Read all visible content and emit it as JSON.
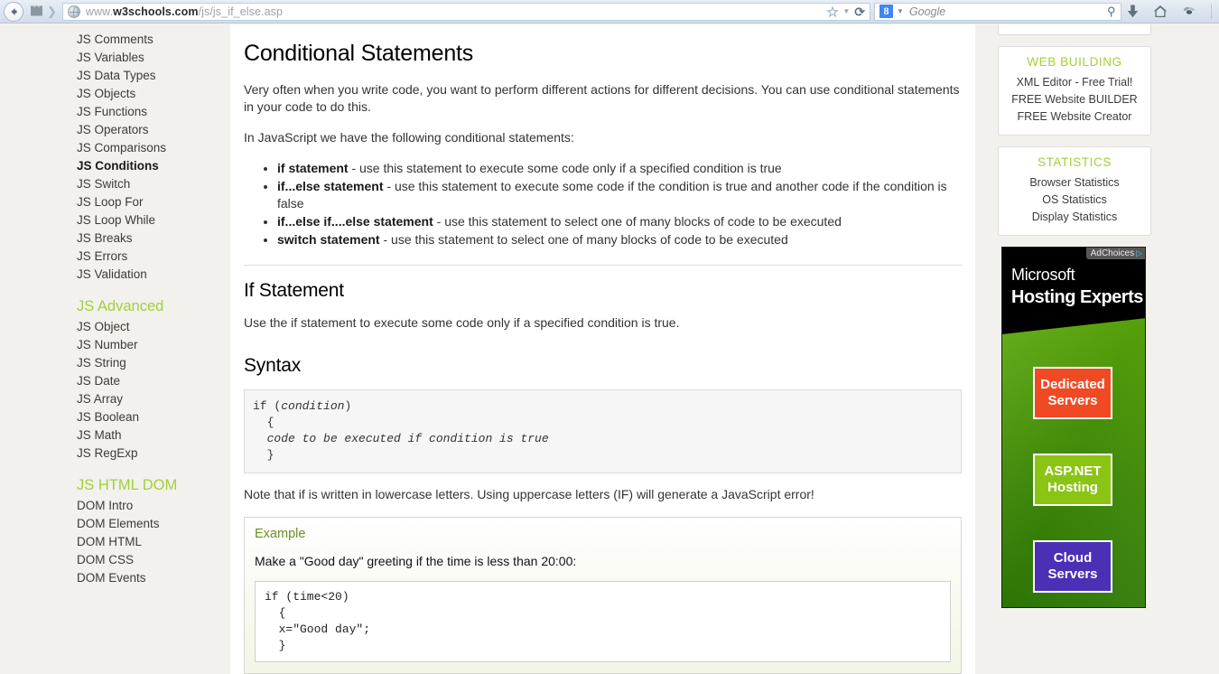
{
  "browser": {
    "back_label": "◀",
    "history_icon_label": "history-list",
    "url_prefix": "www.",
    "url_host": "w3schools.com",
    "url_path": "/js/js_if_else.asp",
    "star_tooltip": "Bookmark this page",
    "reload_label": "⟳",
    "search_engine": "Google",
    "search_engine_badge": "8",
    "search_placeholder": "Google",
    "icons": [
      "download-icon",
      "home-icon",
      "fly-icon"
    ]
  },
  "leftnav": {
    "items": [
      {
        "label": "JS Comments",
        "active": false
      },
      {
        "label": "JS Variables",
        "active": false
      },
      {
        "label": "JS Data Types",
        "active": false
      },
      {
        "label": "JS Objects",
        "active": false
      },
      {
        "label": "JS Functions",
        "active": false
      },
      {
        "label": "JS Operators",
        "active": false
      },
      {
        "label": "JS Comparisons",
        "active": false
      },
      {
        "label": "JS Conditions",
        "active": true
      },
      {
        "label": "JS Switch",
        "active": false
      },
      {
        "label": "JS Loop For",
        "active": false
      },
      {
        "label": "JS Loop While",
        "active": false
      },
      {
        "label": "JS Breaks",
        "active": false
      },
      {
        "label": "JS Errors",
        "active": false
      },
      {
        "label": "JS Validation",
        "active": false
      }
    ],
    "section_advanced": "JS Advanced",
    "advanced_items": [
      {
        "label": "JS Object"
      },
      {
        "label": "JS Number"
      },
      {
        "label": "JS String"
      },
      {
        "label": "JS Date"
      },
      {
        "label": "JS Array"
      },
      {
        "label": "JS Boolean"
      },
      {
        "label": "JS Math"
      },
      {
        "label": "JS RegExp"
      }
    ],
    "section_dom": "JS HTML DOM",
    "dom_items": [
      {
        "label": "DOM Intro"
      },
      {
        "label": "DOM Elements"
      },
      {
        "label": "DOM HTML"
      },
      {
        "label": "DOM CSS"
      },
      {
        "label": "DOM Events"
      }
    ]
  },
  "main": {
    "title": "Conditional Statements",
    "intro": "Very often when you write code, you want to perform different actions for different decisions. You can use conditional statements in your code to do this.",
    "lead": "In JavaScript we have the following conditional statements:",
    "bullets": [
      {
        "term": "if statement",
        "desc": " - use this statement to execute some code only if a specified condition is true"
      },
      {
        "term": "if...else statement",
        "desc": " - use this statement to execute some code if the condition is true and another code if the condition is false"
      },
      {
        "term": "if...else if....else statement",
        "desc": " - use this statement to select one of many blocks of code to be executed"
      },
      {
        "term": "switch statement",
        "desc": " - use this statement to select one of many blocks of code to be executed"
      }
    ],
    "h_if_statement": "If Statement",
    "if_desc": "Use the if statement to execute some code only if a specified condition is true.",
    "h_syntax": "Syntax",
    "syntax_code_line1": "if (",
    "syntax_code_cond": "condition",
    "syntax_code_line2": ")\n  {\n  ",
    "syntax_code_body": "code to be executed if condition is true",
    "syntax_code_line3": "\n  }",
    "note": "Note that if is written in lowercase letters. Using uppercase letters (IF) will generate a JavaScript error!",
    "example_label": "Example",
    "example_desc": "Make a \"Good day\" greeting if the time is less than 20:00:",
    "example_code": "if (time<20)\n  {\n  x=\"Good day\";\n  }"
  },
  "rightcol": {
    "panels": [
      {
        "title": "WEB BUILDING",
        "links": [
          "XML Editor - Free Trial!",
          "FREE Website BUILDER",
          "FREE Website Creator"
        ]
      },
      {
        "title": "STATISTICS",
        "links": [
          "Browser Statistics",
          "OS Statistics",
          "Display Statistics"
        ]
      }
    ],
    "ad": {
      "adchoices": "AdChoices",
      "brand": "Microsoft",
      "headline": "Hosting Experts",
      "buttons": [
        "Dedicated Servers",
        "ASP.NET Hosting",
        "Cloud Servers"
      ]
    }
  },
  "colors": {
    "accent_green": "#a3d037",
    "page_bg": "#f2f1ee",
    "chrome_bg": "#dbe4ef",
    "ad_orange": "#f04a24",
    "ad_lime": "#8cc414",
    "ad_purple": "#4b2fb5"
  }
}
